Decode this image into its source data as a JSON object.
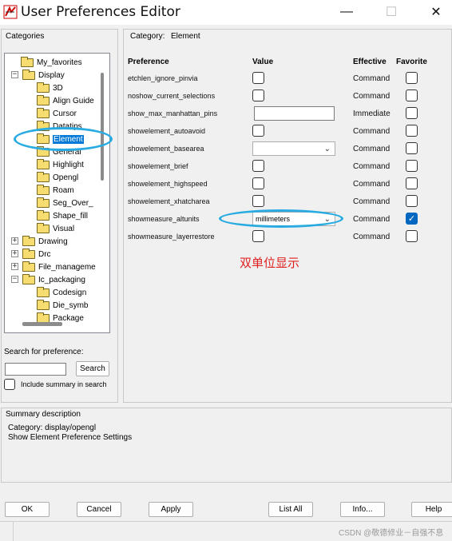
{
  "window": {
    "title": "User Preferences Editor",
    "controls": {
      "minimize": "—",
      "maximize": "☐",
      "close": "✕"
    }
  },
  "categories": {
    "label": "Categories",
    "tree": [
      {
        "label": "My_favorites",
        "level": 1
      },
      {
        "label": "Display",
        "level": 0,
        "expanded": true
      },
      {
        "label": "3D",
        "level": 2
      },
      {
        "label": "Align Guide",
        "level": 2
      },
      {
        "label": "Cursor",
        "level": 2
      },
      {
        "label": "Datatips",
        "level": 2
      },
      {
        "label": "Element",
        "level": 2,
        "selected": true
      },
      {
        "label": "General",
        "level": 2
      },
      {
        "label": "Highlight",
        "level": 2
      },
      {
        "label": "Opengl",
        "level": 2
      },
      {
        "label": "Roam",
        "level": 2
      },
      {
        "label": "Seg_Over_",
        "level": 2
      },
      {
        "label": "Shape_fill",
        "level": 2
      },
      {
        "label": "Visual",
        "level": 2
      },
      {
        "label": "Drawing",
        "level": 0,
        "expanded": false
      },
      {
        "label": "Drc",
        "level": 0,
        "expanded": false
      },
      {
        "label": "File_manageme",
        "level": 0,
        "expanded": false
      },
      {
        "label": "Ic_packaging",
        "level": 0,
        "expanded": true
      },
      {
        "label": "Codesign",
        "level": 2
      },
      {
        "label": "Die_symb",
        "level": 2
      },
      {
        "label": "Package",
        "level": 2
      }
    ]
  },
  "search": {
    "label": "Search for preference:",
    "value": "",
    "button": "Search",
    "include_summary": "Include summary in search"
  },
  "category_header": {
    "label": "Category:",
    "value": "Element"
  },
  "grid": {
    "headers": {
      "preference": "Preference",
      "value": "Value",
      "effective": "Effective",
      "favorite": "Favorite"
    },
    "rows": [
      {
        "name": "etchlen_ignore_pinvia",
        "control": "checkbox",
        "effective": "Command",
        "favorite": false
      },
      {
        "name": "noshow_current_selections",
        "control": "checkbox",
        "effective": "Command",
        "favorite": false
      },
      {
        "name": "show_max_manhattan_pins",
        "control": "text",
        "value": "",
        "effective": "Immediate",
        "favorite": false
      },
      {
        "name": "showelement_autoavoid",
        "control": "checkbox",
        "effective": "Command",
        "favorite": false
      },
      {
        "name": "showelement_basearea",
        "control": "dropdown",
        "value": "",
        "effective": "Command",
        "favorite": false
      },
      {
        "name": "showelement_brief",
        "control": "checkbox",
        "effective": "Command",
        "favorite": false
      },
      {
        "name": "showelement_highspeed",
        "control": "checkbox",
        "effective": "Command",
        "favorite": false
      },
      {
        "name": "showelement_xhatcharea",
        "control": "checkbox",
        "effective": "Command",
        "favorite": false
      },
      {
        "name": "showmeasure_altunits",
        "control": "dropdown",
        "value": "millimeters",
        "effective": "Command",
        "favorite": true
      },
      {
        "name": "showmeasure_layerrestore",
        "control": "checkbox",
        "effective": "Command",
        "favorite": false
      }
    ]
  },
  "annotation": {
    "text": "双单位显示",
    "color": "#e02020",
    "highlight_color": "#29abe2"
  },
  "summary": {
    "label": "Summary description",
    "line1": "Category: display/opengl",
    "line2": "Show Element Preference Settings"
  },
  "buttons": {
    "ok": "OK",
    "cancel": "Cancel",
    "apply": "Apply",
    "list_all": "List All",
    "info": "Info...",
    "help": "Help"
  },
  "watermark": "CSDN @敬德修业－自强不息"
}
